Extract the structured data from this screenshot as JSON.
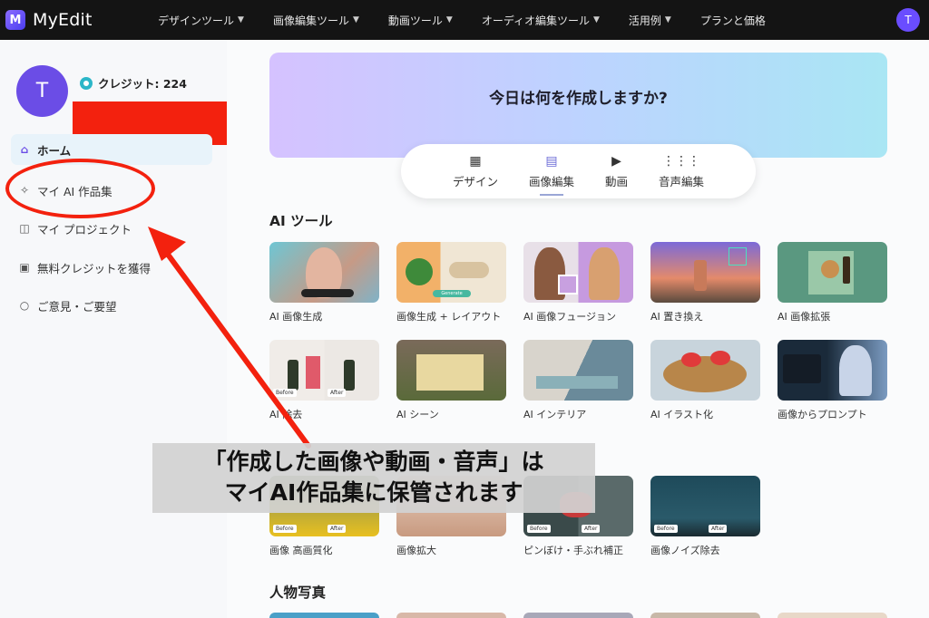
{
  "nav": {
    "brand": "MyEdit",
    "logo_letter": "M",
    "items": [
      "デザインツール",
      "画像編集ツール",
      "動画ツール",
      "オーディオ編集ツール",
      "活用例",
      "プランと価格"
    ],
    "avatar_letter": "T"
  },
  "sidebar": {
    "avatar_letter": "T",
    "credit_label": "クレジット: 224",
    "items": [
      {
        "label": "ホーム",
        "icon": "home-icon",
        "active": true
      },
      {
        "label": "マイ AI 作品集",
        "icon": "sparkle-icon"
      },
      {
        "label": "マイ プロジェクト",
        "icon": "folder-icon"
      },
      {
        "label": "無料クレジットを獲得",
        "icon": "gift-icon"
      },
      {
        "label": "ご意見・ご要望",
        "icon": "chat-icon"
      }
    ]
  },
  "hero": {
    "title": "今日は何を作成しますか?",
    "tabs": [
      "デザイン",
      "画像編集",
      "動画",
      "音声編集"
    ],
    "active_tab": "画像編集"
  },
  "sections": {
    "ai_tools_title": "AI ツール",
    "ai_tools_row1": [
      "AI 画像生成",
      "画像生成 + レイアウト",
      "AI 画像フュージョン",
      "AI 置き換え",
      "AI 画像拡張"
    ],
    "ai_tools_row2": [
      "AI 除去",
      "AI シーン",
      "AI インテリア",
      "AI イラスト化",
      "画像からプロンプト"
    ],
    "enhance_row": [
      "画像 高画質化",
      "画像拡大",
      "ピンぼけ・手ぶれ補正",
      "画像ノイズ除去"
    ],
    "portrait_title": "人物写真"
  },
  "thumb_text": {
    "before": "Before",
    "after": "After",
    "generate": "Generate"
  },
  "annotation": {
    "line1": "「作成した画像や動画・音声」は",
    "line2": "マイAI作品集に保管されます"
  },
  "colors": {
    "accent": "#6b4de6",
    "annotation_red": "#f3210e",
    "topbar": "#141414"
  }
}
